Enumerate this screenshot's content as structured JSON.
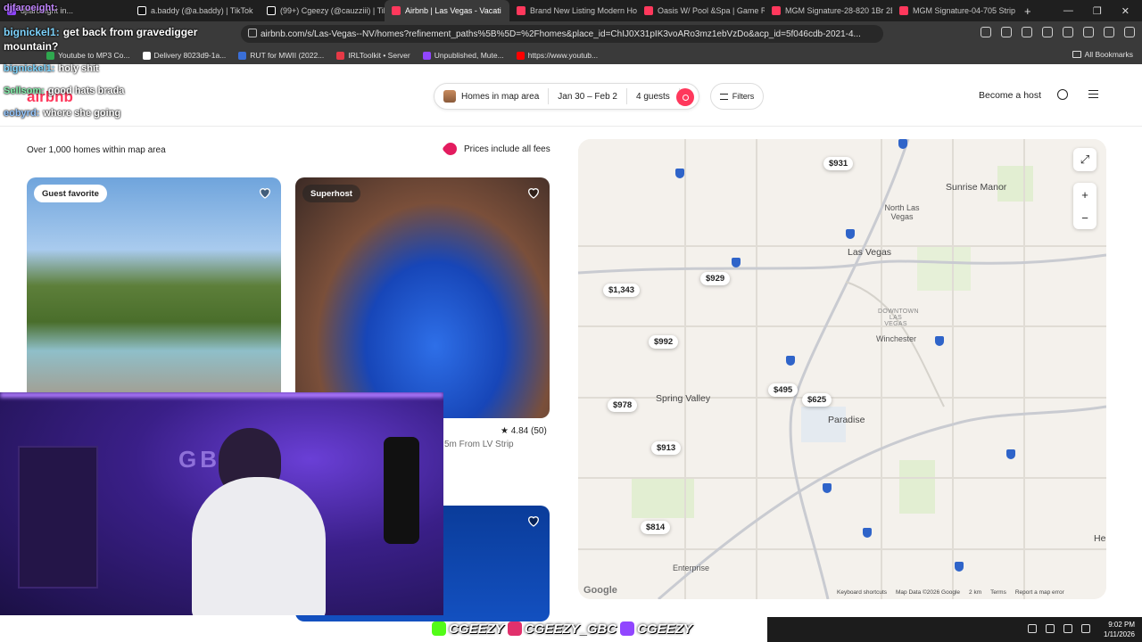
{
  "browser": {
    "tabs": [
      {
        "label": "djfaroeight in...",
        "color": "#9146ff"
      },
      {
        "label": "a.baddy (@a.baddy) | TikTok",
        "color": "#111111"
      },
      {
        "label": "(99+) Cgeezy (@cauzziii) | TikTo",
        "color": "#111111"
      },
      {
        "label": "Airbnb | Las Vegas - Vacati",
        "color": "#ff385c"
      },
      {
        "label": "Brand New Listing Modern Ho",
        "color": "#ff385c"
      },
      {
        "label": "Oasis W/ Pool &Spa | Game R",
        "color": "#ff385c"
      },
      {
        "label": "MGM Signature-28-820 1Br 2E",
        "color": "#ff385c"
      },
      {
        "label": "MGM Signature-04-705 Strip V",
        "color": "#ff385c"
      }
    ],
    "active_tab": 3,
    "url": "airbnb.com/s/Las-Vegas--NV/homes?refinement_paths%5B%5D=%2Fhomes&place_id=ChIJ0X31pIK3voARo3mz1ebVzDo&acp_id=5f046cdb-2021-4...",
    "bookmarks": [
      {
        "label": "Youtube to MP3 Co...",
        "color": "#2fa84f"
      },
      {
        "label": "Delivery 8023d9-1a...",
        "color": "#ffffff"
      },
      {
        "label": "RUT for MWII (2022...",
        "color": "#3a6fd8"
      },
      {
        "label": "IRLToolkit • Server",
        "color": "#e63946"
      },
      {
        "label": "Unpublished, Mute...",
        "color": "#9146ff"
      },
      {
        "label": "https://www.youtub...",
        "color": "#ff0000"
      }
    ],
    "all_bookmarks": "All Bookmarks"
  },
  "header": {
    "logo": "airbnb",
    "search": {
      "location": "Homes in map area",
      "dates": "Jan 30 – Feb 2",
      "guests": "4 guests"
    },
    "filters": "Filters",
    "become_host": "Become a host"
  },
  "listings": {
    "count_text": "Over 1,000 homes within map area",
    "prices_note": "Prices include all fees",
    "cards": [
      {
        "badge": "Guest favorite"
      },
      {
        "badge": "Superhost",
        "rating": "★ 4.84 (50)",
        "subtitle": "5m From LV Strip"
      },
      {
        "badge": ""
      }
    ]
  },
  "map": {
    "price_pins": [
      "$931",
      "$929",
      "$1,343",
      "$992",
      "$495",
      "$625",
      "$978",
      "$913",
      "$814"
    ],
    "labels": {
      "las_vegas": "Las Vegas",
      "sunrise_manor": "Sunrise Manor",
      "north_las_vegas": "North Las Vegas",
      "winchester": "Winchester",
      "spring_valley": "Spring Valley",
      "paradise": "Paradise",
      "enterprise": "Enterprise",
      "downtown": "DOWNTOWN LAS VEGAS",
      "he": "He"
    },
    "footer": [
      "Keyboard shortcuts",
      "Map Data ©2026 Google",
      "2 km",
      "Terms",
      "Report a map error"
    ],
    "google": "Google"
  },
  "overlay": {
    "chat": [
      {
        "user": "djfaroeight:",
        "message": "",
        "color": "#c084fc"
      },
      {
        "user": "bignickel1:",
        "message": "get back from gravedigger mountain?",
        "color": "#7dd3fc"
      },
      {
        "user": "bignickel1:",
        "message": "holy shit",
        "color": "#7dd3fc"
      },
      {
        "user": "Sellsom:",
        "message": "good hats brada",
        "color": "#86efac"
      },
      {
        "user": "eobyrd:",
        "message": "where she going",
        "color": "#93c5fd"
      }
    ],
    "webcam_sign": "GBC",
    "socials": [
      {
        "handle": "CGEEZY",
        "color": "#53fc18"
      },
      {
        "handle": "CGEEZY_GBC",
        "color": "#e1306c"
      },
      {
        "handle": "CGEEZY",
        "color": "#9146ff"
      }
    ]
  },
  "taskbar": {
    "time": "9:02 PM",
    "date": "1/11/2026"
  }
}
